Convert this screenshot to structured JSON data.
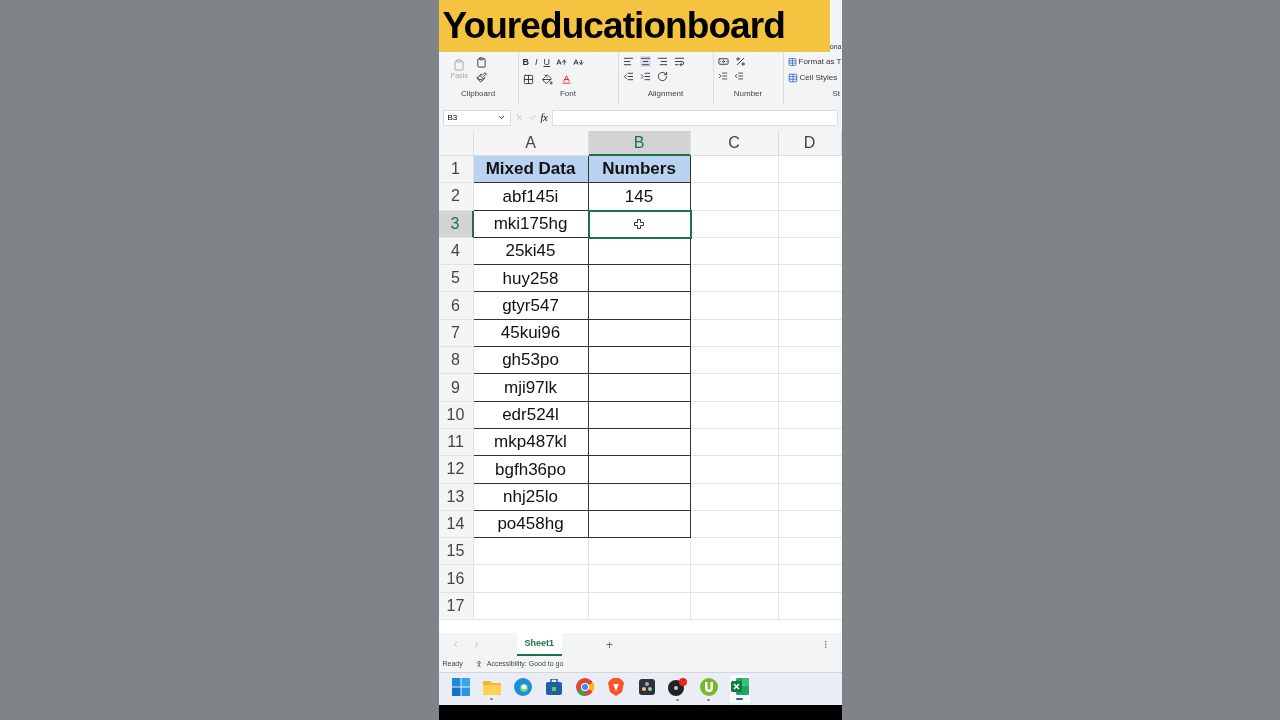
{
  "banner": {
    "text": "Youreducationboard"
  },
  "ribbon": {
    "top_fragment": "ona",
    "paste_label": "Paste",
    "font_buttons": [
      "B",
      "I",
      "U"
    ],
    "groups": [
      "Clipboard",
      "Font",
      "Alignment",
      "Number",
      "St"
    ],
    "style_buttons": [
      "Format as T",
      "Cell Styles"
    ]
  },
  "formula_bar": {
    "name_box": "B3",
    "function_label": "fx"
  },
  "columns": [
    {
      "label": "A",
      "selected": false
    },
    {
      "label": "B",
      "selected": true
    },
    {
      "label": "C",
      "selected": false
    },
    {
      "label": "D",
      "selected": false
    }
  ],
  "rows": [
    {
      "label": "1",
      "kind": "header",
      "selected": false,
      "a": "Mixed Data",
      "b": "Numbers"
    },
    {
      "label": "2",
      "kind": "data",
      "selected": false,
      "a": "abf145i",
      "b": "145"
    },
    {
      "label": "3",
      "kind": "data",
      "selected": true,
      "a": "mki175hg"
    },
    {
      "label": "4",
      "kind": "data",
      "selected": false,
      "a": "25ki45"
    },
    {
      "label": "5",
      "kind": "data",
      "selected": false,
      "a": "huy258"
    },
    {
      "label": "6",
      "kind": "data",
      "selected": false,
      "a": "gtyr547"
    },
    {
      "label": "7",
      "kind": "data",
      "selected": false,
      "a": "45kui96"
    },
    {
      "label": "8",
      "kind": "data",
      "selected": false,
      "a": "gh53po"
    },
    {
      "label": "9",
      "kind": "data",
      "selected": false,
      "a": "mji97lk"
    },
    {
      "label": "10",
      "kind": "data",
      "selected": false,
      "a": "edr524l"
    },
    {
      "label": "11",
      "kind": "data",
      "selected": false,
      "a": "mkp487kl"
    },
    {
      "label": "12",
      "kind": "data",
      "selected": false,
      "a": "bgfh36po"
    },
    {
      "label": "13",
      "kind": "data",
      "selected": false,
      "a": "nhj25lo"
    },
    {
      "label": "14",
      "kind": "data",
      "selected": false,
      "a": "po458hg"
    },
    {
      "label": "15",
      "kind": "empty",
      "selected": false
    },
    {
      "label": "16",
      "kind": "empty",
      "selected": false
    },
    {
      "label": "17",
      "kind": "empty",
      "selected": false
    }
  ],
  "sheet_tabs": [
    {
      "label": "Sheet1",
      "selected": true
    }
  ],
  "new_sheet": "+",
  "status_bar": {
    "mode": "Ready",
    "accessibility": "Accessibility: Good to go"
  },
  "taskbar": [
    {
      "kind": "start",
      "running": false,
      "selected": false
    },
    {
      "kind": "folder",
      "running": true,
      "selected": false
    },
    {
      "kind": "edge",
      "running": false,
      "selected": false
    },
    {
      "kind": "store",
      "running": false,
      "selected": false
    },
    {
      "kind": "chrome",
      "running": false,
      "selected": false
    },
    {
      "kind": "brave",
      "running": false,
      "selected": false
    },
    {
      "kind": "dark",
      "running": false,
      "selected": false
    },
    {
      "kind": "disc",
      "running": true,
      "selected": false
    },
    {
      "kind": "torrent",
      "running": true,
      "selected": false
    },
    {
      "kind": "excel",
      "running": true,
      "selected": true
    }
  ]
}
